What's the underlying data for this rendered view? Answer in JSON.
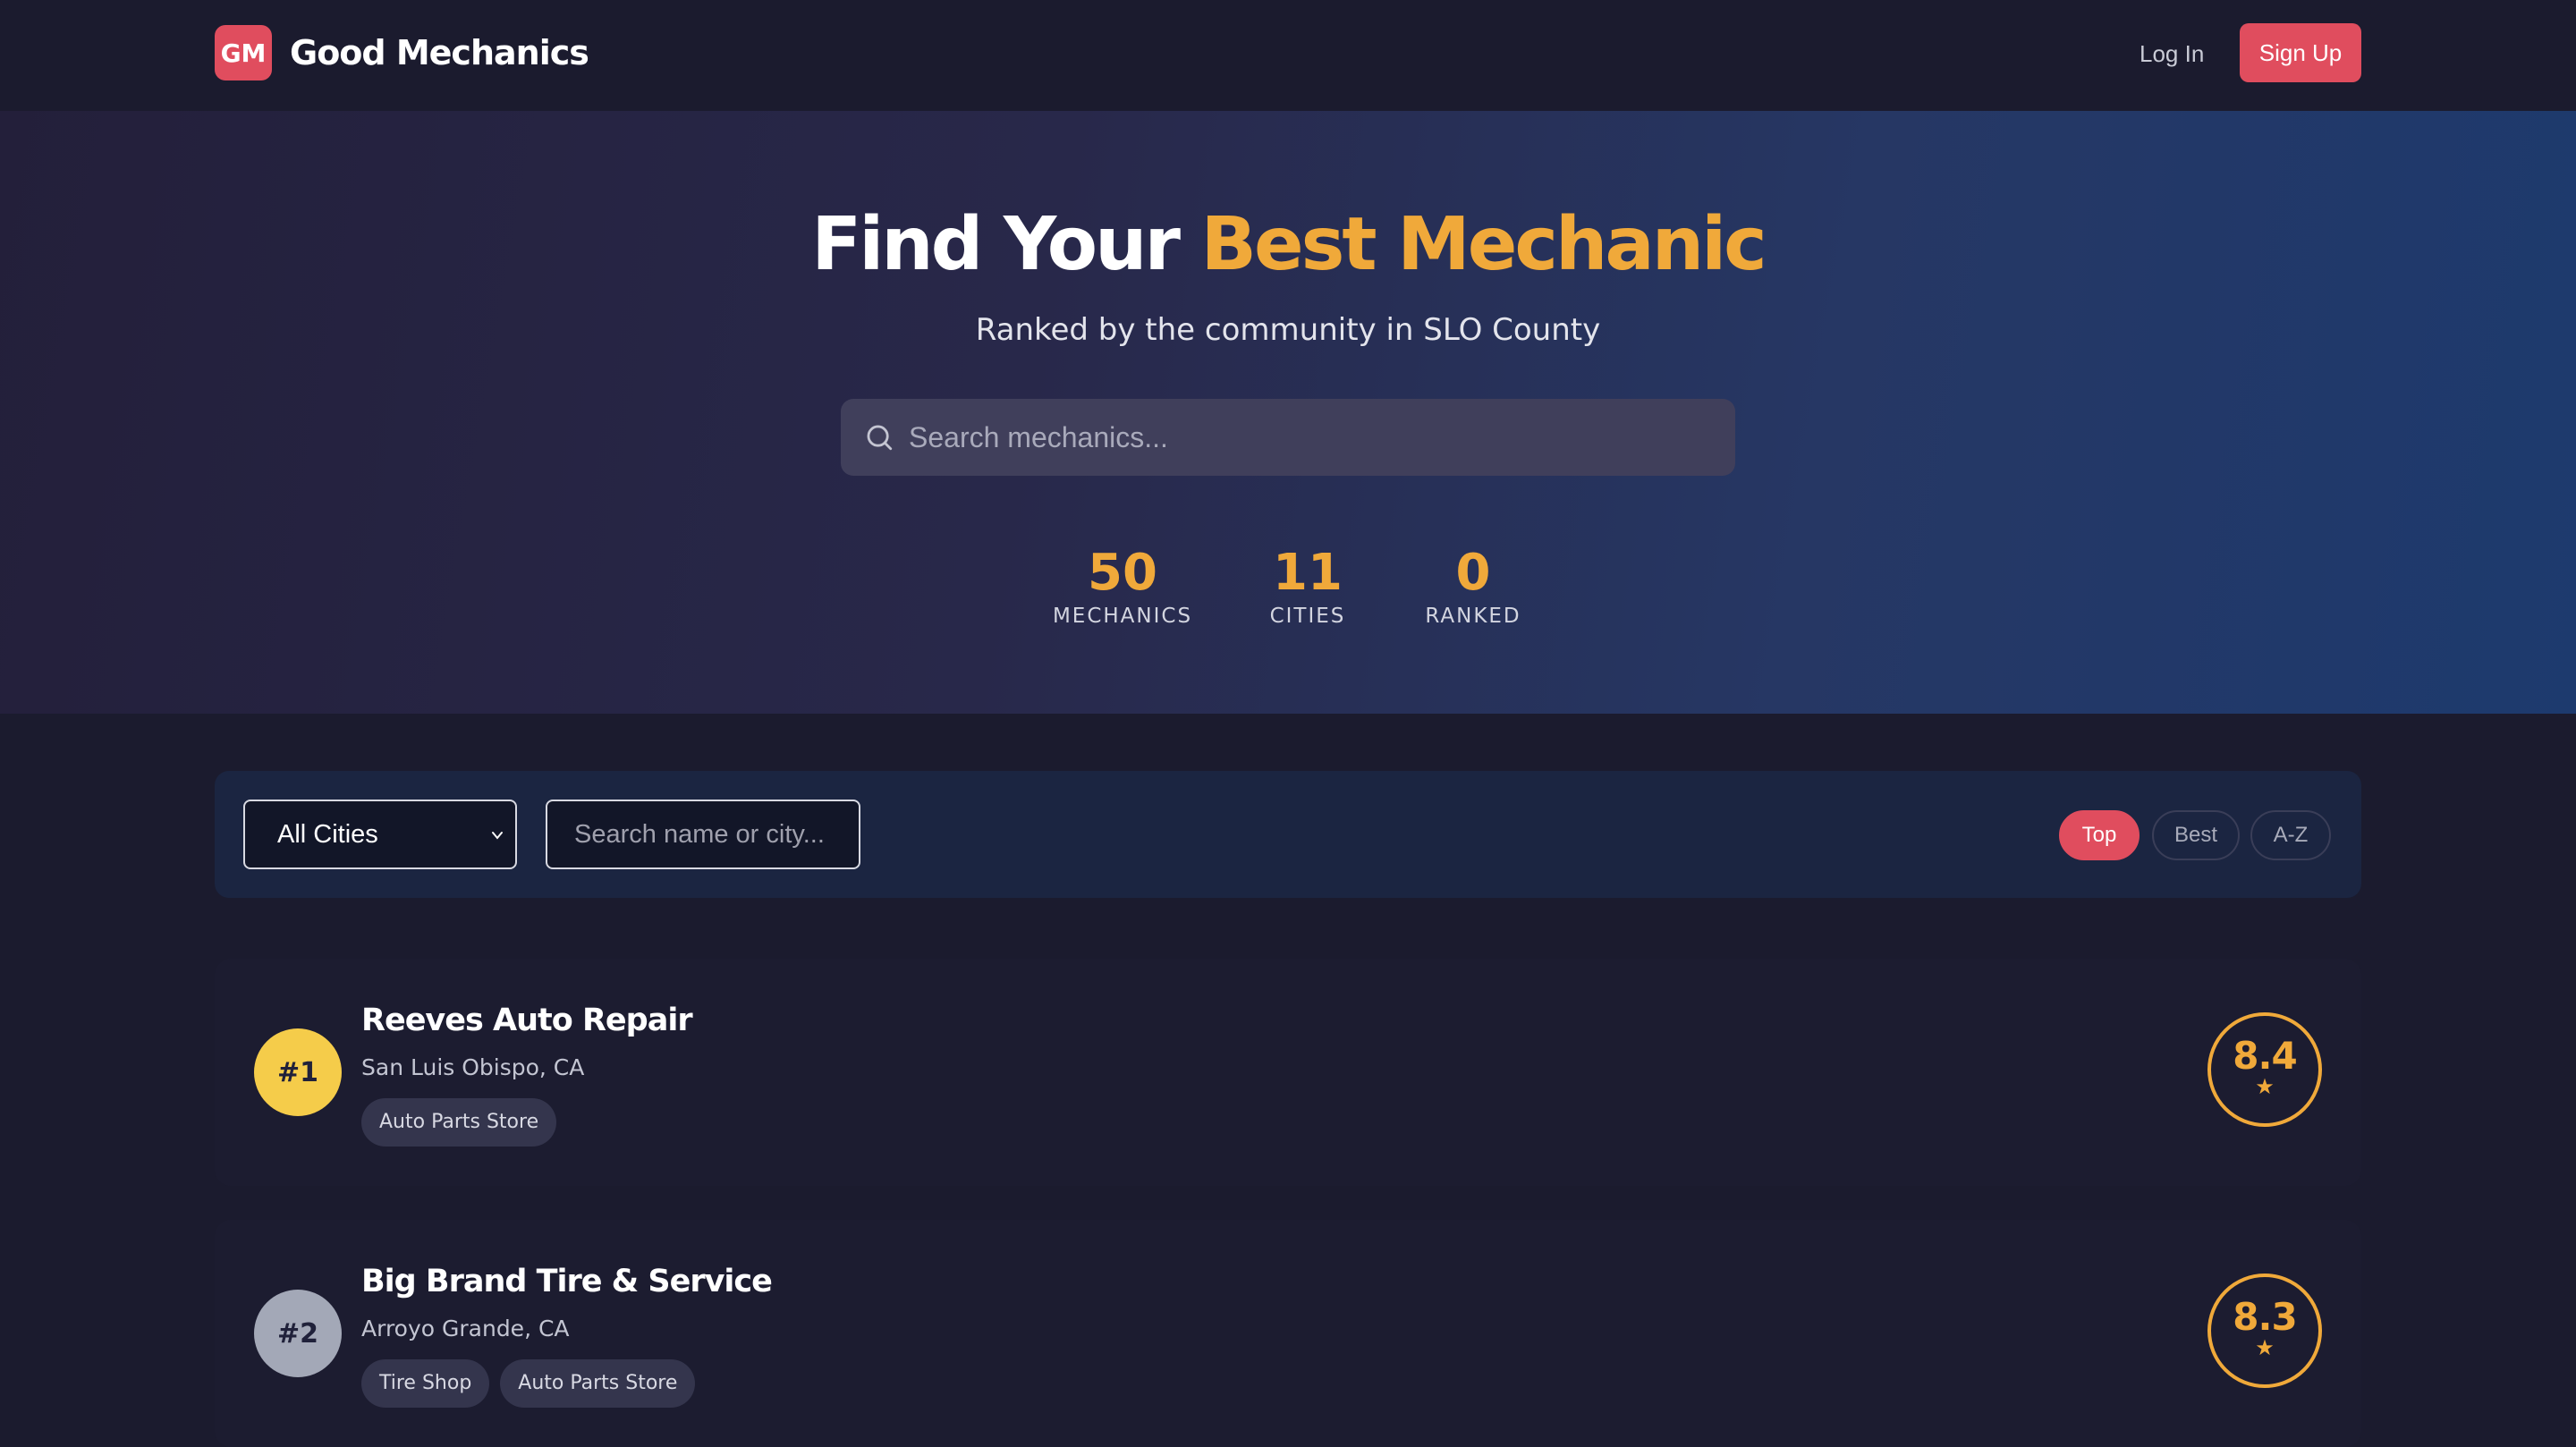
{
  "nav": {
    "logo_text": "GM",
    "brand_name": "Good Mechanics",
    "login_label": "Log In",
    "signup_label": "Sign Up"
  },
  "hero": {
    "title_prefix": "Find Your",
    "title_accent": "Best Mechanic",
    "subtitle": "Ranked by the community in SLO County",
    "search_placeholder": "Search mechanics...",
    "stats": [
      {
        "value": "50",
        "label": "MECHANICS"
      },
      {
        "value": "11",
        "label": "CITIES"
      },
      {
        "value": "0",
        "label": "RANKED"
      }
    ]
  },
  "filters": {
    "city_selected": "All Cities",
    "name_search_placeholder": "Search name or city...",
    "sort_options": [
      "Top",
      "Best",
      "A-Z"
    ],
    "active_sort": "Top"
  },
  "mechanics": [
    {
      "rank": "#1",
      "name": "Reeves Auto Repair",
      "location": "San Luis Obispo, CA",
      "tags": [
        "Auto Parts Store"
      ],
      "score": "8.4"
    },
    {
      "rank": "#2",
      "name": "Big Brand Tire & Service",
      "location": "Arroyo Grande, CA",
      "tags": [
        "Tire Shop",
        "Auto Parts Store"
      ],
      "score": "8.3"
    }
  ],
  "colors": {
    "accent": "#e04d5e",
    "gold": "#f0a93a",
    "rank1_badge": "#f5cc4a",
    "rank2_badge": "#a3a8b7"
  },
  "icons": {
    "search": "search-icon",
    "select_chevron": "chevron-down-icon",
    "score_star": "star-icon"
  }
}
